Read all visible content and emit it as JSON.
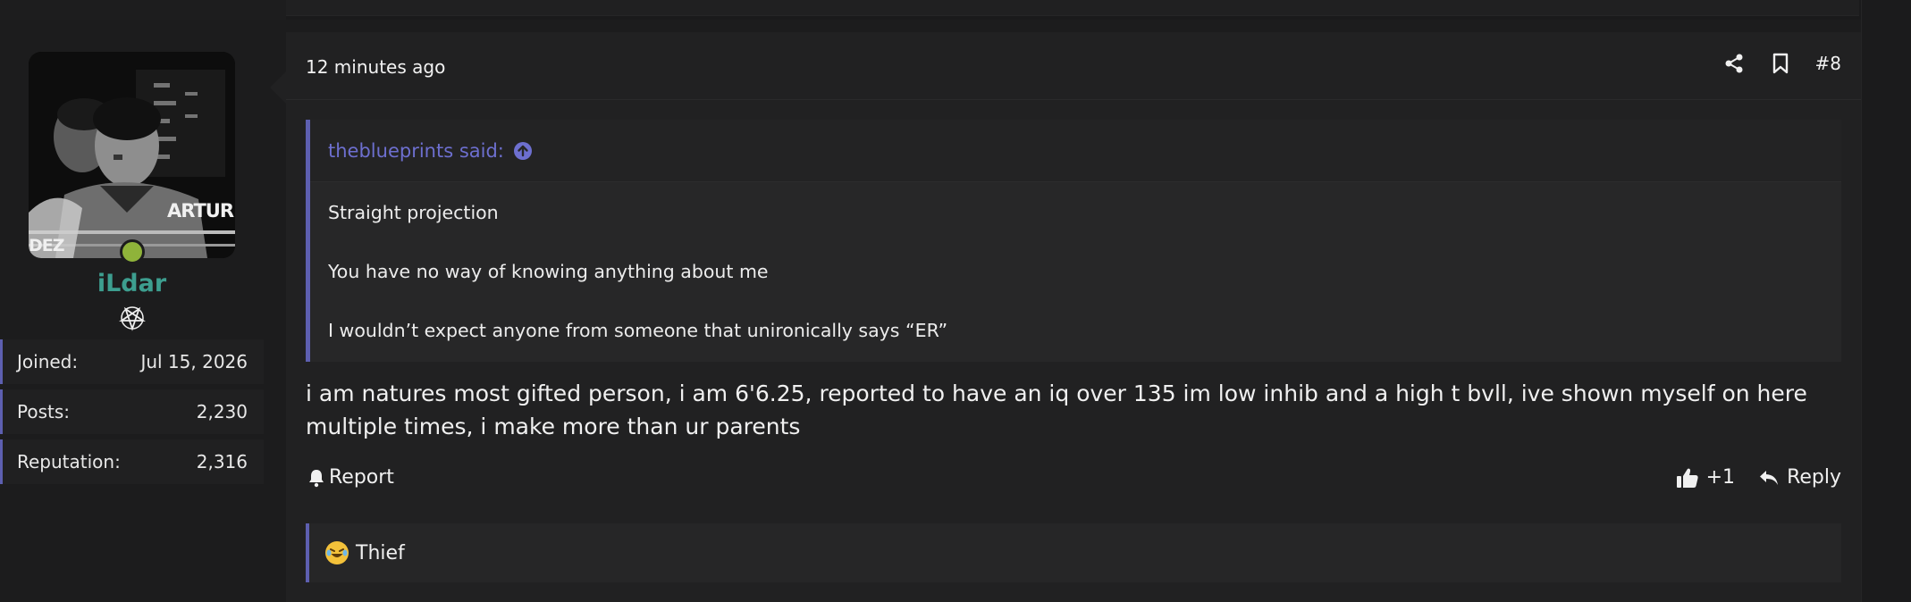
{
  "post": {
    "timestamp": "12 minutes ago",
    "number": "#8",
    "quote": {
      "author_line": "theblueprints said:",
      "lines": [
        "Straight projection",
        "You have no way of knowing anything about me",
        "I wouldn’t expect anyone from someone that unironically says “ER”"
      ]
    },
    "message": "i am natures most gifted person, i am 6'6.25, reported to have an iq over 135 im low inhib and a high t bvll, ive shown myself on here multiple times, i make more than ur parents",
    "actions": {
      "report_label": "Report",
      "like_count": "+1",
      "reply_label": "Reply"
    },
    "reaction": {
      "label": "Thief",
      "icon": "crying-laughing-emoji-icon"
    }
  },
  "user": {
    "username": "iLdar",
    "avatar_text_right": "ARTUR",
    "avatar_text_left": "DEZ",
    "stats": [
      {
        "label": "Joined:",
        "value": "Jul 15, 2026"
      },
      {
        "label": "Posts:",
        "value": "2,230"
      },
      {
        "label": "Reputation:",
        "value": "2,316"
      }
    ]
  },
  "colors": {
    "accent": "#5d5fb0",
    "username": "#3d9e8f",
    "online": "#8fb33a",
    "quote_author": "#6d6fcf"
  }
}
